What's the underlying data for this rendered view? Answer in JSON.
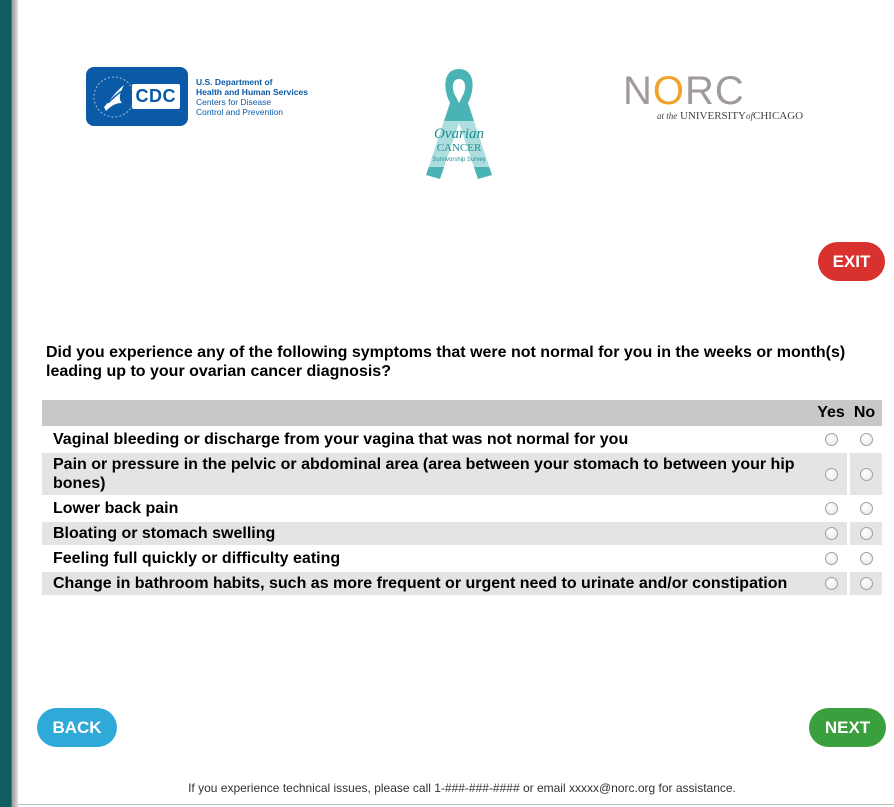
{
  "logos": {
    "cdc": {
      "tag": "CDC",
      "line1": "U.S. Department of",
      "line2": "Health and Human Services",
      "line3": "Centers for Disease",
      "line4": "Control and Prevention"
    },
    "ribbon": {
      "line1": "Ovarian",
      "line2": "CANCER",
      "line3": "Survivorship Survey"
    },
    "norc": {
      "word_n": "N",
      "word_o": "O",
      "word_rc": "RC",
      "sub_at": "at the",
      "sub_univ": "UNIVERSITY",
      "sub_of": "of",
      "sub_chicago": "CHICAGO"
    }
  },
  "buttons": {
    "exit": "EXIT",
    "back": "BACK",
    "next": "NEXT"
  },
  "question": "Did you experience any of the following symptoms that were not normal for you in the weeks or month(s) leading up to your ovarian cancer diagnosis?",
  "table": {
    "columns": [
      "Yes",
      "No"
    ],
    "rows": [
      "Vaginal bleeding or discharge from your vagina that was not normal for you",
      "Pain or pressure in the pelvic or abdominal area (area between your stomach to between your hip bones)",
      "Lower back pain",
      "Bloating or stomach swelling",
      "Feeling full quickly or difficulty eating",
      "Change in bathroom habits, such as more frequent or urgent need to urinate and/or constipation"
    ]
  },
  "footer": "If you experience technical issues, please call 1-###-###-#### or email xxxxx@norc.org for assistance.",
  "colors": {
    "exit": "#d9312d",
    "back": "#2ea9d8",
    "next": "#3a9f3d",
    "cdc_blue": "#0a5aa8",
    "ribbon_teal": "#2aa6a8"
  }
}
